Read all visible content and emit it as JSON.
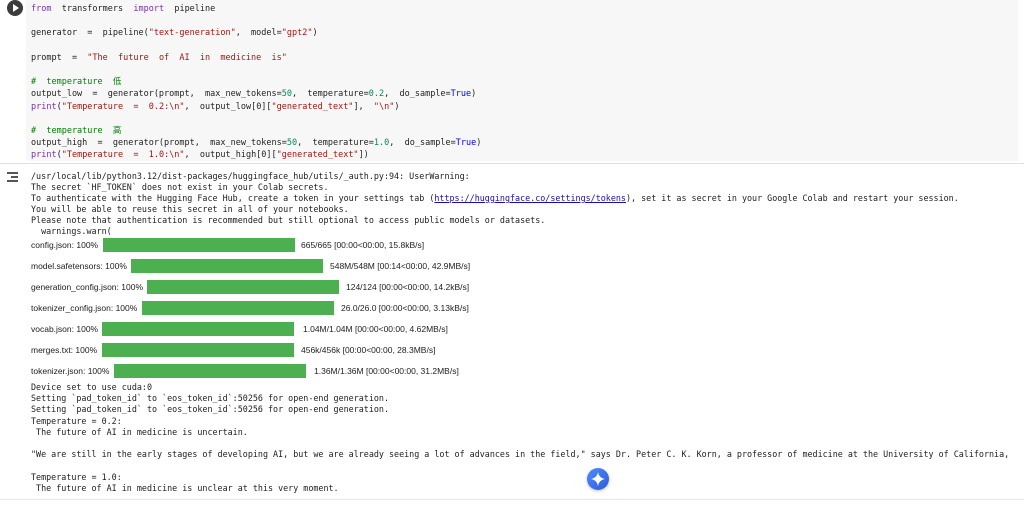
{
  "code_lines": [
    [
      {
        "t": "from",
        "c": "kw"
      },
      {
        "t": "  transformers  "
      },
      {
        "t": "import",
        "c": "kw"
      },
      {
        "t": "  pipeline"
      }
    ],
    [],
    [
      {
        "t": "generator  =  pipeline("
      },
      {
        "t": "\"text-generation\"",
        "c": "str"
      },
      {
        "t": ",  model="
      },
      {
        "t": "\"gpt2\"",
        "c": "str"
      },
      {
        "t": ")"
      }
    ],
    [],
    [
      {
        "t": "prompt  =  "
      },
      {
        "t": "\"The  future  of  AI  in  medicine  is\"",
        "c": "str"
      }
    ],
    [],
    [
      {
        "t": "#  temperature  低",
        "c": "cm"
      }
    ],
    [
      {
        "t": "output_low  =  generator(prompt,  max_new_tokens="
      },
      {
        "t": "50",
        "c": "num"
      },
      {
        "t": ",  temperature="
      },
      {
        "t": "0.2",
        "c": "num"
      },
      {
        "t": ",  do_sample="
      },
      {
        "t": "True",
        "c": "bool"
      },
      {
        "t": ")"
      }
    ],
    [
      {
        "t": "print",
        "c": "kw"
      },
      {
        "t": "("
      },
      {
        "t": "\"Temperature  =  0.2:\\n\"",
        "c": "str"
      },
      {
        "t": ",  output_low[0]["
      },
      {
        "t": "\"generated_text\"",
        "c": "str"
      },
      {
        "t": "],  "
      },
      {
        "t": "\"\\n\"",
        "c": "str"
      },
      {
        "t": ")"
      }
    ],
    [],
    [
      {
        "t": "#  temperature  高",
        "c": "cm"
      }
    ],
    [
      {
        "t": "output_high  =  generator(prompt,  max_new_tokens="
      },
      {
        "t": "50",
        "c": "num"
      },
      {
        "t": ",  temperature="
      },
      {
        "t": "1.0",
        "c": "num"
      },
      {
        "t": ",  do_sample="
      },
      {
        "t": "True",
        "c": "bool"
      },
      {
        "t": ")"
      }
    ],
    [
      {
        "t": "print",
        "c": "kw"
      },
      {
        "t": "("
      },
      {
        "t": "\"Temperature  =  1.0:\\n\"",
        "c": "str"
      },
      {
        "t": ",  output_high[0]["
      },
      {
        "t": "\"generated_text\"",
        "c": "str"
      },
      {
        "t": "])"
      }
    ]
  ],
  "output": {
    "warning_path": "/usr/local/lib/python3.12/dist-packages/huggingface_hub/utils/_auth.py:94: UserWarning:",
    "warning_line1": "The secret `HF_TOKEN` does not exist in your Colab secrets.",
    "warning_line2_before": "To authenticate with the Hugging Face Hub, create a token in your settings tab (",
    "warning_link": "https://huggingface.co/settings/tokens",
    "warning_line2_after": "), set it as secret in your Google Colab and restart your session.",
    "warning_line3": "You will be able to reuse this secret in all of your notebooks.",
    "warning_line4": "Please note that authentication is recommended but still optional to access public models or datasets.",
    "warning_line5": "  warnings.warn(",
    "downloads": [
      {
        "name": "config.json:  100%",
        "progress": 1.0,
        "stat": "665/665  [00:00<00:00,  15.8kB/s]"
      },
      {
        "name": "model.safetensors:  100%",
        "progress": 1.0,
        "stat": "548M/548M  [00:14<00:00,  42.9MB/s]"
      },
      {
        "name": "generation_config.json:  100%",
        "progress": 1.0,
        "stat": "124/124  [00:00<00:00,  14.2kB/s]"
      },
      {
        "name": "tokenizer_config.json:  100%",
        "progress": 1.0,
        "stat": "26.0/26.0  [00:00<00:00,  3.13kB/s]"
      },
      {
        "name": "vocab.json:  100%",
        "progress": 1.0,
        "stat": "1.04M/1.04M  [00:00<00:00,  4.62MB/s]"
      },
      {
        "name": "merges.txt:  100%",
        "progress": 1.0,
        "stat": "456k/456k  [00:00<00:00,  28.3MB/s]"
      },
      {
        "name": "tokenizer.json:  100%",
        "progress": 1.0,
        "stat": "1.36M/1.36M  [00:00<00:00,  31.2MB/s]"
      }
    ],
    "result_lines": [
      "Device set to use cuda:0",
      "Setting `pad_token_id` to `eos_token_id`:50256 for open-end generation.",
      "Setting `pad_token_id` to `eos_token_id`:50256 for open-end generation.",
      "Temperature = 0.2:",
      " The future of AI in medicine is uncertain.",
      "",
      "\"We are still in the early stages of developing AI, but we are already seeing a lot of advances in the field,\" says Dr. Peter C. K. Korn, a professor of medicine at the University of California,",
      "",
      "Temperature = 1.0:",
      " The future of AI in medicine is unclear at this very moment."
    ]
  },
  "colors": {
    "progress_fill": "#4caf50",
    "keyword": "#7b30a8",
    "string": "#a31515",
    "number": "#098658",
    "comment": "#008000"
  },
  "icons": {
    "run": "play-circle-icon",
    "output_menu": "output-actions-icon",
    "gemini": "gemini-sparkle-icon"
  }
}
